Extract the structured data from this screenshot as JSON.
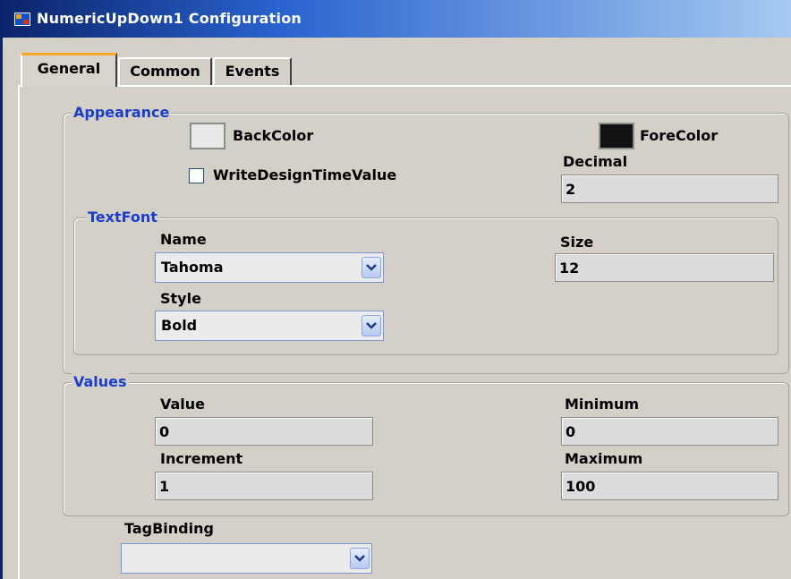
{
  "window": {
    "title": "NumericUpDown1 Configuration"
  },
  "tabs": [
    {
      "label": "General",
      "active": true
    },
    {
      "label": "Common",
      "active": false
    },
    {
      "label": "Events",
      "active": false
    }
  ],
  "appearance": {
    "legend": "Appearance",
    "back_color_label": "BackColor",
    "back_color": "#e8e8e8",
    "fore_color_label": "ForeColor",
    "fore_color": "#111111",
    "write_design_label": "WriteDesignTimeValue",
    "write_design_checked": false,
    "decimal_label": "Decimal",
    "decimal_value": "2"
  },
  "text_font": {
    "legend": "TextFont",
    "name_label": "Name",
    "name_value": "Tahoma",
    "size_label": "Size",
    "size_value": "12",
    "style_label": "Style",
    "style_value": "Bold"
  },
  "values": {
    "legend": "Values",
    "value_label": "Value",
    "value": "0",
    "minimum_label": "Minimum",
    "minimum": "0",
    "increment_label": "Increment",
    "increment": "1",
    "maximum_label": "Maximum",
    "maximum": "100"
  },
  "tag_binding": {
    "label": "TagBinding",
    "value": ""
  },
  "colors": {
    "group_title": "#1a3ec8",
    "title_bar": "#0a246a",
    "active_tab_accent": "#f5a623"
  },
  "icons": {
    "app": "app-icon",
    "dropdown": "chevron-down-icon"
  }
}
